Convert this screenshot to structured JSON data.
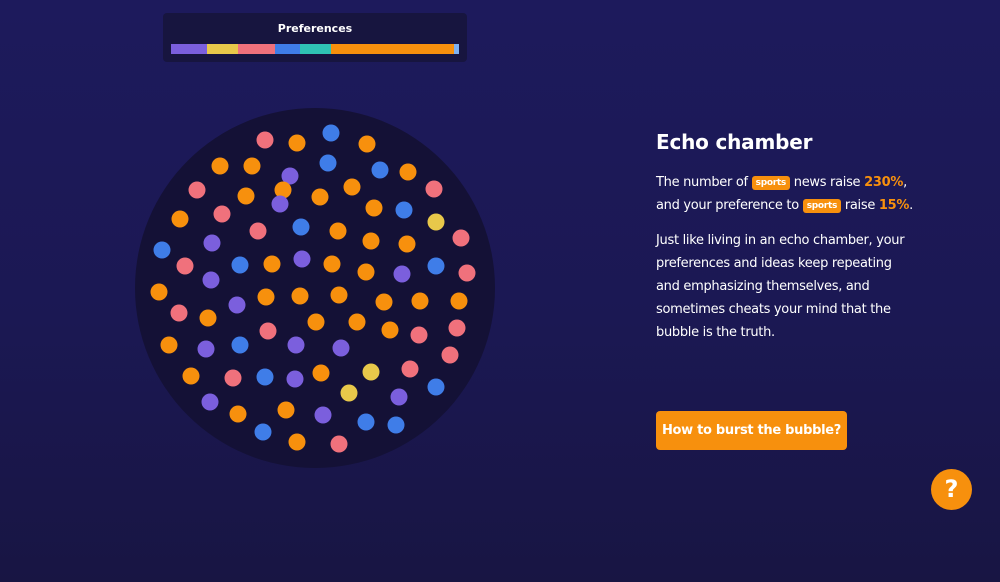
{
  "preferences": {
    "title": "Preferences",
    "segments": [
      {
        "category": "purple",
        "color": "#7b5fdd",
        "share": 0.125
      },
      {
        "category": "yellow",
        "color": "#e8c84a",
        "share": 0.108
      },
      {
        "category": "pink",
        "color": "#f0717c",
        "share": 0.128
      },
      {
        "category": "blue",
        "color": "#3f7de8",
        "share": 0.087
      },
      {
        "category": "teal",
        "color": "#2fc3b4",
        "share": 0.108
      },
      {
        "category": "orange",
        "color": "#f7900d",
        "share": 0.427
      },
      {
        "category": "light-blue",
        "color": "#7fb1f0",
        "share": 0.017
      }
    ]
  },
  "bubble": {
    "background": "#141136",
    "colors": {
      "orange": "#f7900d",
      "pink": "#f0717c",
      "blue": "#3f7de8",
      "purple": "#7b5fdd",
      "yellow": "#e8c84a"
    }
  },
  "panel": {
    "title": "Echo chamber",
    "stat": {
      "p1": "The number of",
      "tag1": "sports",
      "p2": "news raise",
      "pct1": "230%",
      "p3": ",",
      "p4": "and your preference to",
      "tag2": "sports",
      "p5": "raise",
      "pct2": "15%",
      "p6": "."
    },
    "body": "Just like living in an echo chamber, your preferences and ideas keep repeating and emphasizing themselves, and sometimes cheats your mind that the bubble is the truth."
  },
  "cta_label": "How to burst the bubble?",
  "help_label": "?"
}
